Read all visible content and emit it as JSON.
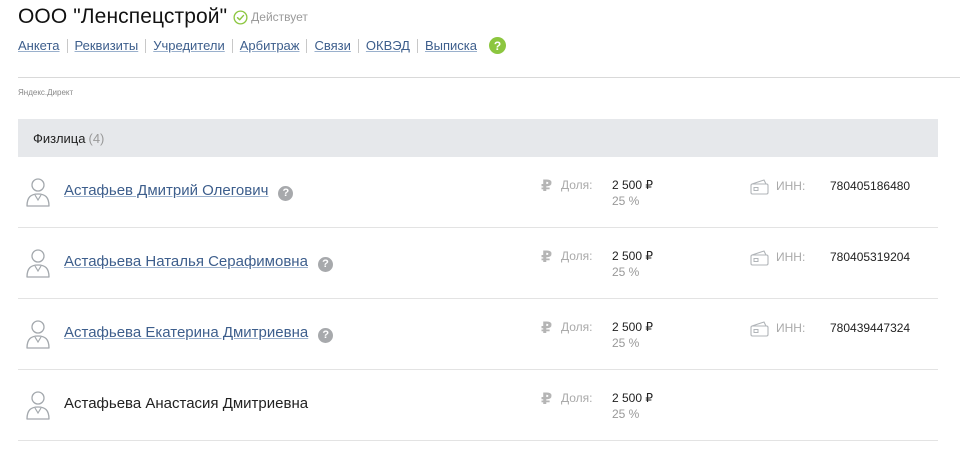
{
  "company": {
    "name": "ООО \"Ленспецстрой\"",
    "status": "Действует"
  },
  "nav": {
    "items": [
      "Анкета",
      "Реквизиты",
      "Учредители",
      "Арбитраж",
      "Связи",
      "ОКВЭД",
      "Выписка"
    ],
    "help": "?"
  },
  "ad_label": "Яндекс.Директ",
  "section": {
    "title": "Физлица",
    "count": "(4)"
  },
  "founders": [
    {
      "name": "Астафьев Дмитрий Олегович",
      "share_label": "Доля:",
      "amount": "2 500 ₽",
      "percent": "25 %",
      "inn_label": "ИНН:",
      "inn": "780405186480"
    },
    {
      "name": "Астафьева Наталья Серафимовна",
      "share_label": "Доля:",
      "amount": "2 500 ₽",
      "percent": "25 %",
      "inn_label": "ИНН:",
      "inn": "780405319204"
    },
    {
      "name": "Астафьева Екатерина Дмитриевна",
      "share_label": "Доля:",
      "amount": "2 500 ₽",
      "percent": "25 %",
      "inn_label": "ИНН:",
      "inn": "780439447324"
    },
    {
      "name": "Астафьева Анастасия Дмитриевна",
      "share_label": "Доля:",
      "amount": "2 500 ₽",
      "percent": "25 %"
    }
  ],
  "question_mark": "?",
  "ruble_symbol": "₽",
  "colors": {
    "link": "#3d5e8c",
    "status_green": "#8cc63f",
    "section_bg": "#e6e8eb"
  },
  "icons": {
    "status": "check-circle-icon",
    "person": "person-outline-icon",
    "card": "id-card-icon",
    "currency": "ruble-icon"
  }
}
